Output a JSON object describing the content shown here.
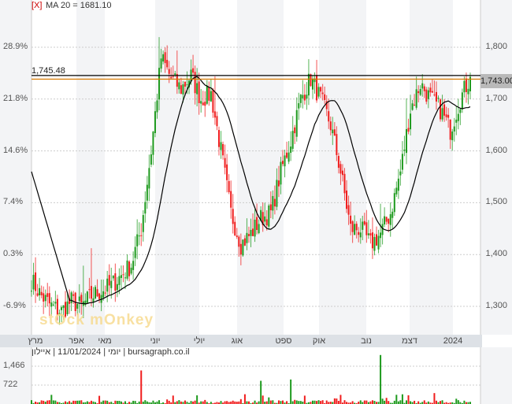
{
  "header": {
    "close_marker": "[X]",
    "ma_label": "MA 20 = 1681.10"
  },
  "footer": {
    "caption": "יומי | 11/01/2024 | איילון | bursagraph.co.il"
  },
  "watermark": "stOck mOnkey",
  "colors": {
    "up": "#1e9a1e",
    "down": "#f01c1c",
    "ma": "#000000",
    "last_line": "#d97a00",
    "shade": "#f3f4f6"
  },
  "chart_data": {
    "type": "candlestick",
    "title": "MA 20 = 1681.10",
    "price_axis": {
      "ticks": [
        1300,
        1400,
        1500,
        1600,
        1700,
        1800
      ],
      "labels": [
        "1,300",
        "1,400",
        "1,500",
        "1,600",
        "1,700",
        "1,800"
      ],
      "range": [
        1244,
        1865
      ]
    },
    "percent_axis": {
      "labels": [
        "-6.9%",
        "0.3%",
        "7.4%",
        "14.6%",
        "21.8%",
        "28.9%"
      ]
    },
    "months": [
      "מרץ",
      "אפר",
      "מאי",
      "יוני",
      "יולי",
      "אוג",
      "ספט",
      "אוק",
      "נוב",
      "דצמ",
      "2024"
    ],
    "horizontal_lines": [
      {
        "label": "1,745.48",
        "value": 1745.48,
        "color": "#000000"
      },
      {
        "label": "1,743.00",
        "value": 1743,
        "color": "#d97a00"
      }
    ],
    "weekly_close": [
      1350,
      1320,
      1300,
      1290,
      1310,
      1300,
      1320,
      1330,
      1340,
      1360,
      1380,
      1450,
      1600,
      1780,
      1740,
      1720,
      1745,
      1700,
      1710,
      1600,
      1480,
      1420,
      1440,
      1470,
      1480,
      1560,
      1620,
      1700,
      1740,
      1700,
      1650,
      1560,
      1450,
      1450,
      1420,
      1440,
      1480,
      1560,
      1680,
      1730,
      1700,
      1680,
      1640,
      1700,
      1743
    ],
    "volume_axis": {
      "labels": [
        "1,466",
        "722"
      ],
      "values": [
        1466,
        722
      ]
    },
    "volume_spikes": [
      {
        "week": 11,
        "value": 1300
      },
      {
        "week": 23,
        "value": 900
      },
      {
        "week": 26,
        "value": 950
      },
      {
        "week": 35,
        "value": 1900
      }
    ]
  }
}
